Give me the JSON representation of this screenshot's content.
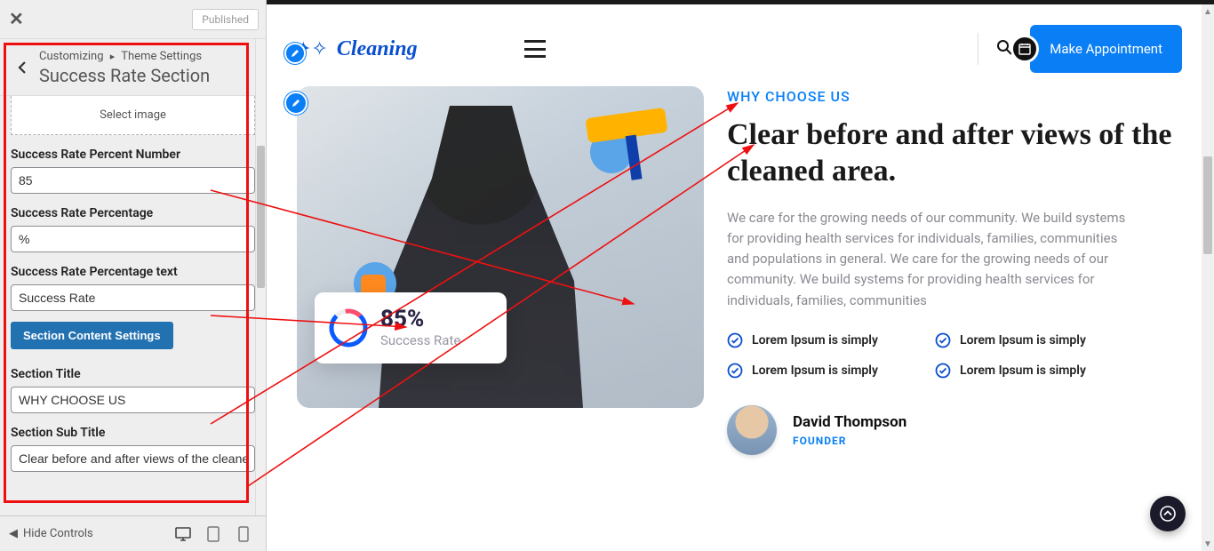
{
  "customizer": {
    "published": "Published",
    "crumb_prefix": "Customizing",
    "crumb_link": "Theme Settings",
    "section_heading": "Success Rate Section",
    "select_image": "Select image",
    "labels": {
      "percent_number": "Success Rate Percent Number",
      "percentage": "Success Rate Percentage",
      "percentage_text": "Success Rate Percentage text",
      "section_title": "Section Title",
      "section_subtitle": "Section Sub Title"
    },
    "values": {
      "percent_number": "85",
      "percentage": "%",
      "percentage_text": "Success Rate",
      "section_title": "WHY CHOOSE US",
      "section_subtitle": "Clear before and after views of the cleaned area."
    },
    "content_settings_btn": "Section Content Settings",
    "hide_controls": "Hide Controls"
  },
  "preview": {
    "brand": "Cleaning",
    "appointment_btn": "Make Appointment",
    "rate_card": {
      "percent": "85",
      "symbol": "%",
      "label": "Success Rate"
    },
    "eyebrow": "WHY CHOOSE US",
    "headline": "Clear before and after views of the cleaned area.",
    "paragraph": "We care for the growing needs of our community. We build systems for providing health services for individuals, families, communities and populations in general. We care for the growing needs of our community. We build systems for providing health services for individuals, families, communities",
    "check_item": "Lorem Ipsum is simply",
    "person": {
      "name": "David Thompson",
      "role": "FOUNDER"
    }
  }
}
